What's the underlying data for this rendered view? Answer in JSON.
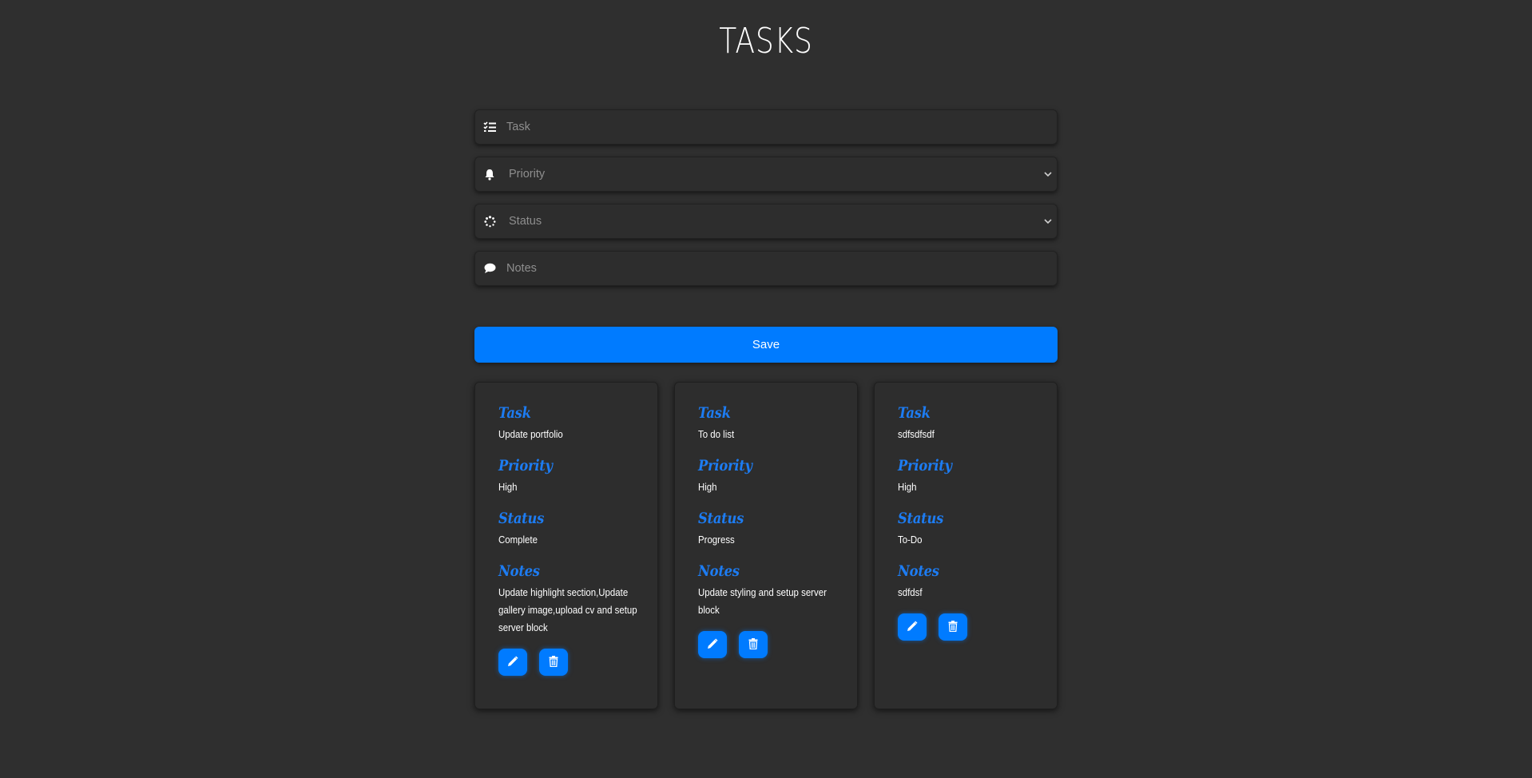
{
  "header": {
    "title": "TASKS"
  },
  "form": {
    "task_placeholder": "Task",
    "priority_placeholder": "Priority",
    "status_placeholder": "Status",
    "notes_placeholder": "Notes",
    "save_label": "Save"
  },
  "labels": {
    "task": "Task",
    "priority": "Priority",
    "status": "Status",
    "notes": "Notes"
  },
  "tasks": [
    {
      "task": "Update portfolio",
      "priority": "High",
      "status": "Complete",
      "notes": "Update highlight section,Update gallery image,upload cv and setup server block"
    },
    {
      "task": "To do list",
      "priority": "High",
      "status": "Progress",
      "notes": "Update styling and setup server block"
    },
    {
      "task": "sdfsdfsdf",
      "priority": "High",
      "status": "To-Do",
      "notes": "sdfdsf"
    }
  ],
  "colors": {
    "accent": "#007bff",
    "background": "#2f2f2f",
    "label": "#1d7cf2"
  },
  "icons": {
    "task": "list-check-icon",
    "priority": "bell-icon",
    "status": "spinner-icon",
    "notes": "comment-icon",
    "edit": "pencil-icon",
    "delete": "trash-icon"
  }
}
